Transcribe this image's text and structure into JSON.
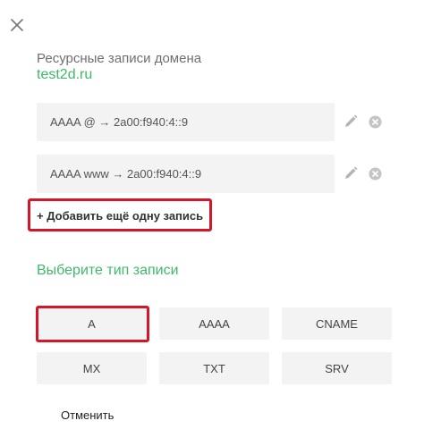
{
  "header": {
    "close_icon": "close-icon"
  },
  "domain": {
    "title": "Ресурсные записи домена",
    "name": "test2d.ru"
  },
  "records": [
    {
      "text": "AAAA @ → 2a00:f940:4::9"
    },
    {
      "text": "AAAA www → 2a00:f940:4::9"
    }
  ],
  "actions": {
    "add_record_label": "+ Добавить ещё одну запись",
    "cancel_label": "Отменить"
  },
  "record_types": {
    "title": "Выберите тип записи",
    "types": [
      "A",
      "AAAA",
      "CNAME",
      "MX",
      "TXT",
      "SRV"
    ]
  },
  "colors": {
    "accent": "#3fb86a",
    "highlight": "#d4152a",
    "tile_background": "#f3f3f3",
    "icon": "#b5b5b5"
  }
}
